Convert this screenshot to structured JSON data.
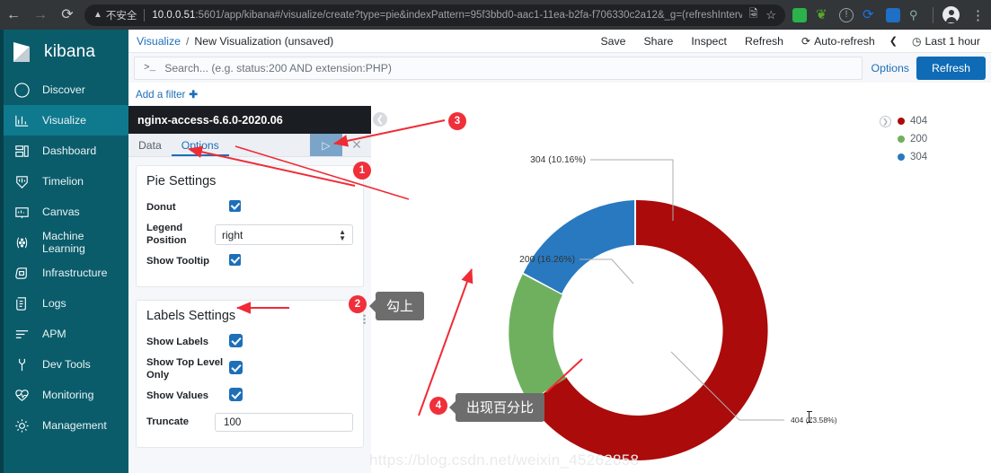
{
  "browser": {
    "back_icon": "back-arrow",
    "forward_icon": "forward-arrow",
    "reload_icon": "reload",
    "security_label": "不安全",
    "url_host": "10.0.0.51",
    "url_rest": ":5601/app/kibana#/visualize/create?type=pie&indexPattern=95f3bbd0-aac1-11ea-b2fa-f706330c2a12&_g=(refreshInterval:(pause...",
    "translate_icon": "translate-icon",
    "bookmark_icon": "star-icon",
    "extensions": [
      "tampermonkey-icon",
      "evernote-icon",
      "info-icon",
      "sync-icon",
      "office-icon",
      "key-icon"
    ],
    "profile_icon": "account-avatar",
    "menu_icon": "kebab-menu-icon"
  },
  "sidebar": {
    "brand": "kibana",
    "items": [
      {
        "label": "Discover",
        "icon": "compass-icon",
        "active": false
      },
      {
        "label": "Visualize",
        "icon": "bar-chart-icon",
        "active": true
      },
      {
        "label": "Dashboard",
        "icon": "dashboard-icon",
        "active": false
      },
      {
        "label": "Timelion",
        "icon": "timelion-icon",
        "active": false
      },
      {
        "label": "Canvas",
        "icon": "canvas-icon",
        "active": false
      },
      {
        "label": "Machine Learning",
        "icon": "machine-learning-icon",
        "active": false
      },
      {
        "label": "Infrastructure",
        "icon": "infrastructure-icon",
        "active": false
      },
      {
        "label": "Logs",
        "icon": "logs-icon",
        "active": false
      },
      {
        "label": "APM",
        "icon": "apm-icon",
        "active": false
      },
      {
        "label": "Dev Tools",
        "icon": "wrench-icon",
        "active": false
      },
      {
        "label": "Monitoring",
        "icon": "heartbeat-icon",
        "active": false
      },
      {
        "label": "Management",
        "icon": "gear-icon",
        "active": false
      }
    ]
  },
  "topnav": {
    "breadcrumb_root": "Visualize",
    "breadcrumb_sep": "/",
    "breadcrumb_current": "New Visualization (unsaved)",
    "actions": [
      {
        "label": "Save",
        "icon": ""
      },
      {
        "label": "Share",
        "icon": ""
      },
      {
        "label": "Inspect",
        "icon": ""
      },
      {
        "label": "Refresh",
        "icon": ""
      },
      {
        "label": "Auto-refresh",
        "icon": "refresh-cycle-icon"
      }
    ],
    "collapse_caret": "❮",
    "time_picker": {
      "icon": "clock-icon",
      "label": "Last 1 hour"
    }
  },
  "query": {
    "prompt": ">_",
    "placeholder": "Search... (e.g. status:200 AND extension:PHP)",
    "value": "",
    "options_label": "Options",
    "refresh_label": "Refresh"
  },
  "filters": {
    "add_label": "Add a filter",
    "add_icon": "plus-icon"
  },
  "editor": {
    "index_title": "nginx-access-6.6.0-2020.06",
    "tabs": [
      {
        "label": "Data",
        "active": false
      },
      {
        "label": "Options",
        "active": true
      }
    ],
    "apply_icon": "play-apply-icon",
    "cancel_icon": "close-icon",
    "pie_settings": {
      "header": "Pie Settings",
      "donut": {
        "label": "Donut",
        "checked": true
      },
      "legend_position": {
        "label": "Legend Position",
        "value": "right"
      },
      "show_tooltip": {
        "label": "Show Tooltip",
        "checked": true
      }
    },
    "labels_settings": {
      "header": "Labels Settings",
      "show_labels": {
        "label": "Show Labels",
        "checked": true
      },
      "show_top_level_only": {
        "label": "Show Top Level Only",
        "checked": true
      },
      "show_values": {
        "label": "Show Values",
        "checked": true
      },
      "truncate": {
        "label": "Truncate",
        "value": "100"
      }
    }
  },
  "visualization": {
    "collapse_icon": "chevron-left-icon",
    "drag_handle_icon": "drag-dots-icon",
    "watermark": "https://blog.csdn.net/weixin_45262858",
    "legend_expand_icon": "chevron-right-circle-icon"
  },
  "chart_data": {
    "type": "pie",
    "variant": "donut",
    "title": "",
    "labels": [
      "404",
      "200",
      "304"
    ],
    "values": [
      73.58,
      16.26,
      10.16
    ],
    "colors": [
      "#ab0b0b",
      "#6fb05f",
      "#2879c0"
    ],
    "slice_labels": [
      "404 (73.58%)",
      "200 (16.26%)",
      "304 (10.16%)"
    ],
    "legend": {
      "position": "right",
      "entries": [
        {
          "label": "404",
          "color": "#ab0b0b"
        },
        {
          "label": "200",
          "color": "#6fb05f"
        },
        {
          "label": "304",
          "color": "#2879c0"
        }
      ]
    },
    "show_labels": true,
    "show_values": true,
    "units": "percent"
  },
  "annotations": [
    {
      "number": "1",
      "text": ""
    },
    {
      "number": "2",
      "text": "勾上"
    },
    {
      "number": "3",
      "text": ""
    },
    {
      "number": "4",
      "text": "出现百分比"
    }
  ]
}
